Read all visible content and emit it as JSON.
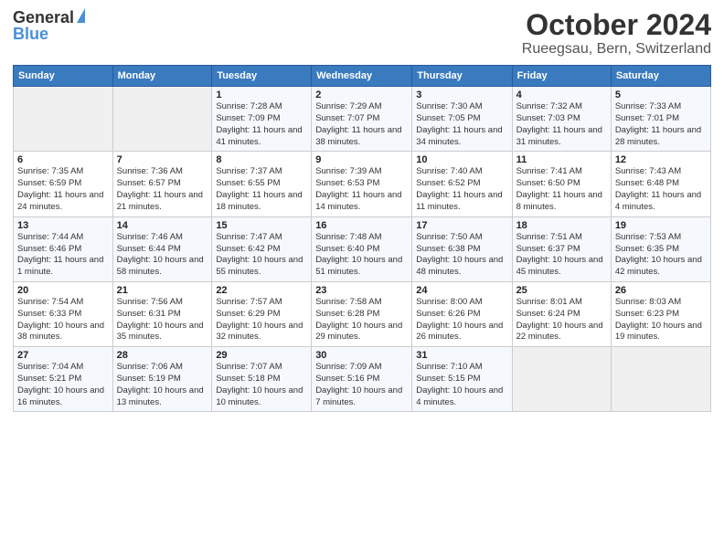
{
  "header": {
    "logo_general": "General",
    "logo_blue": "Blue",
    "title": "October 2024",
    "location": "Rueegsau, Bern, Switzerland"
  },
  "days_of_week": [
    "Sunday",
    "Monday",
    "Tuesday",
    "Wednesday",
    "Thursday",
    "Friday",
    "Saturday"
  ],
  "weeks": [
    [
      {
        "day": "",
        "info": ""
      },
      {
        "day": "",
        "info": ""
      },
      {
        "day": "1",
        "info": "Sunrise: 7:28 AM\nSunset: 7:09 PM\nDaylight: 11 hours and 41 minutes."
      },
      {
        "day": "2",
        "info": "Sunrise: 7:29 AM\nSunset: 7:07 PM\nDaylight: 11 hours and 38 minutes."
      },
      {
        "day": "3",
        "info": "Sunrise: 7:30 AM\nSunset: 7:05 PM\nDaylight: 11 hours and 34 minutes."
      },
      {
        "day": "4",
        "info": "Sunrise: 7:32 AM\nSunset: 7:03 PM\nDaylight: 11 hours and 31 minutes."
      },
      {
        "day": "5",
        "info": "Sunrise: 7:33 AM\nSunset: 7:01 PM\nDaylight: 11 hours and 28 minutes."
      }
    ],
    [
      {
        "day": "6",
        "info": "Sunrise: 7:35 AM\nSunset: 6:59 PM\nDaylight: 11 hours and 24 minutes."
      },
      {
        "day": "7",
        "info": "Sunrise: 7:36 AM\nSunset: 6:57 PM\nDaylight: 11 hours and 21 minutes."
      },
      {
        "day": "8",
        "info": "Sunrise: 7:37 AM\nSunset: 6:55 PM\nDaylight: 11 hours and 18 minutes."
      },
      {
        "day": "9",
        "info": "Sunrise: 7:39 AM\nSunset: 6:53 PM\nDaylight: 11 hours and 14 minutes."
      },
      {
        "day": "10",
        "info": "Sunrise: 7:40 AM\nSunset: 6:52 PM\nDaylight: 11 hours and 11 minutes."
      },
      {
        "day": "11",
        "info": "Sunrise: 7:41 AM\nSunset: 6:50 PM\nDaylight: 11 hours and 8 minutes."
      },
      {
        "day": "12",
        "info": "Sunrise: 7:43 AM\nSunset: 6:48 PM\nDaylight: 11 hours and 4 minutes."
      }
    ],
    [
      {
        "day": "13",
        "info": "Sunrise: 7:44 AM\nSunset: 6:46 PM\nDaylight: 11 hours and 1 minute."
      },
      {
        "day": "14",
        "info": "Sunrise: 7:46 AM\nSunset: 6:44 PM\nDaylight: 10 hours and 58 minutes."
      },
      {
        "day": "15",
        "info": "Sunrise: 7:47 AM\nSunset: 6:42 PM\nDaylight: 10 hours and 55 minutes."
      },
      {
        "day": "16",
        "info": "Sunrise: 7:48 AM\nSunset: 6:40 PM\nDaylight: 10 hours and 51 minutes."
      },
      {
        "day": "17",
        "info": "Sunrise: 7:50 AM\nSunset: 6:38 PM\nDaylight: 10 hours and 48 minutes."
      },
      {
        "day": "18",
        "info": "Sunrise: 7:51 AM\nSunset: 6:37 PM\nDaylight: 10 hours and 45 minutes."
      },
      {
        "day": "19",
        "info": "Sunrise: 7:53 AM\nSunset: 6:35 PM\nDaylight: 10 hours and 42 minutes."
      }
    ],
    [
      {
        "day": "20",
        "info": "Sunrise: 7:54 AM\nSunset: 6:33 PM\nDaylight: 10 hours and 38 minutes."
      },
      {
        "day": "21",
        "info": "Sunrise: 7:56 AM\nSunset: 6:31 PM\nDaylight: 10 hours and 35 minutes."
      },
      {
        "day": "22",
        "info": "Sunrise: 7:57 AM\nSunset: 6:29 PM\nDaylight: 10 hours and 32 minutes."
      },
      {
        "day": "23",
        "info": "Sunrise: 7:58 AM\nSunset: 6:28 PM\nDaylight: 10 hours and 29 minutes."
      },
      {
        "day": "24",
        "info": "Sunrise: 8:00 AM\nSunset: 6:26 PM\nDaylight: 10 hours and 26 minutes."
      },
      {
        "day": "25",
        "info": "Sunrise: 8:01 AM\nSunset: 6:24 PM\nDaylight: 10 hours and 22 minutes."
      },
      {
        "day": "26",
        "info": "Sunrise: 8:03 AM\nSunset: 6:23 PM\nDaylight: 10 hours and 19 minutes."
      }
    ],
    [
      {
        "day": "27",
        "info": "Sunrise: 7:04 AM\nSunset: 5:21 PM\nDaylight: 10 hours and 16 minutes."
      },
      {
        "day": "28",
        "info": "Sunrise: 7:06 AM\nSunset: 5:19 PM\nDaylight: 10 hours and 13 minutes."
      },
      {
        "day": "29",
        "info": "Sunrise: 7:07 AM\nSunset: 5:18 PM\nDaylight: 10 hours and 10 minutes."
      },
      {
        "day": "30",
        "info": "Sunrise: 7:09 AM\nSunset: 5:16 PM\nDaylight: 10 hours and 7 minutes."
      },
      {
        "day": "31",
        "info": "Sunrise: 7:10 AM\nSunset: 5:15 PM\nDaylight: 10 hours and 4 minutes."
      },
      {
        "day": "",
        "info": ""
      },
      {
        "day": "",
        "info": ""
      }
    ]
  ]
}
